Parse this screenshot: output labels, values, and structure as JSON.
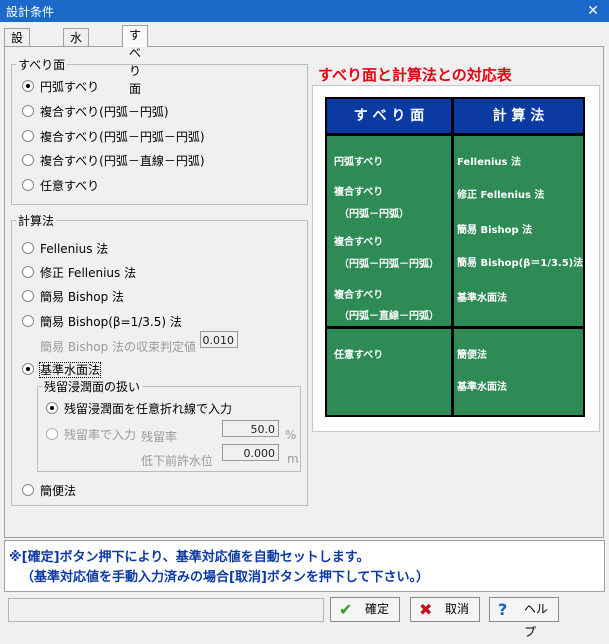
{
  "window": {
    "title": "設計条件",
    "close_label": "✕"
  },
  "tabs": [
    {
      "label": "設計基準"
    },
    {
      "label": "水の状態"
    },
    {
      "label": "すべり面"
    }
  ],
  "slip_surface": {
    "legend": "すべり面",
    "options": [
      {
        "label": "円弧すべり",
        "selected": true
      },
      {
        "label": "複合すべり(円弧－円弧)",
        "selected": false
      },
      {
        "label": "複合すべり(円弧－円弧－円弧)",
        "selected": false
      },
      {
        "label": "複合すべり(円弧－直線－円弧)",
        "selected": false
      },
      {
        "label": "任意すべり",
        "selected": false
      }
    ]
  },
  "calc_method": {
    "legend": "計算法",
    "options": [
      {
        "label": "Fellenius 法",
        "selected": false
      },
      {
        "label": "修正 Fellenius 法",
        "selected": false
      },
      {
        "label": "簡易 Bishop 法",
        "selected": false
      },
      {
        "label": "簡易 Bishop(β=1/3.5) 法",
        "selected": false
      },
      {
        "label": "基準水面法",
        "selected": true
      },
      {
        "label": "簡便法",
        "selected": false
      }
    ],
    "convergence": {
      "label": "簡易 Bishop 法の収束判定値",
      "value": "0.010"
    },
    "residual": {
      "legend": "残留浸潤面の扱い",
      "options": [
        {
          "label": "残留浸潤面を任意折れ線で入力",
          "selected": true
        },
        {
          "label": "残留率で入力",
          "selected": false
        }
      ],
      "rate_label": "残留率",
      "rate_value": "50.0",
      "rate_unit": "%",
      "level_label": "低下前許水位",
      "level_value": "0.000",
      "level_unit": "m"
    }
  },
  "table": {
    "title": "すべり面と計算法との対応表",
    "headers": [
      "す べ り 面",
      "計 算 法"
    ],
    "upper_left": [
      "円弧すべり",
      "複合すべり",
      "（円弧－円弧）",
      "複合すべり",
      "（円弧－円弧－円弧）",
      "複合すべり",
      "（円弧－直線－円弧）"
    ],
    "upper_right": [
      "Fellenius 法",
      "修正 Fellenius 法",
      "簡易 Bishop 法",
      "簡易 Bishop(β＝1/3.5)法",
      "基準水面法"
    ],
    "lower_left": [
      "任意すべり"
    ],
    "lower_right": [
      "簡便法",
      "基準水面法"
    ]
  },
  "status": {
    "line1": "※[確定]ボタン押下により、基準対応値を自動セットします。",
    "line2": "（基準対応値を手動入力済みの場合[取消]ボタンを押下して下さい。）"
  },
  "buttons": {
    "ok": "確定",
    "cancel": "取消",
    "help": "ヘルプ"
  },
  "colors": {
    "title_red": "#e60012",
    "header_blue": "#0b3aa3",
    "cell_green": "#2e8b55",
    "status_blue": "#0b3aa3"
  }
}
